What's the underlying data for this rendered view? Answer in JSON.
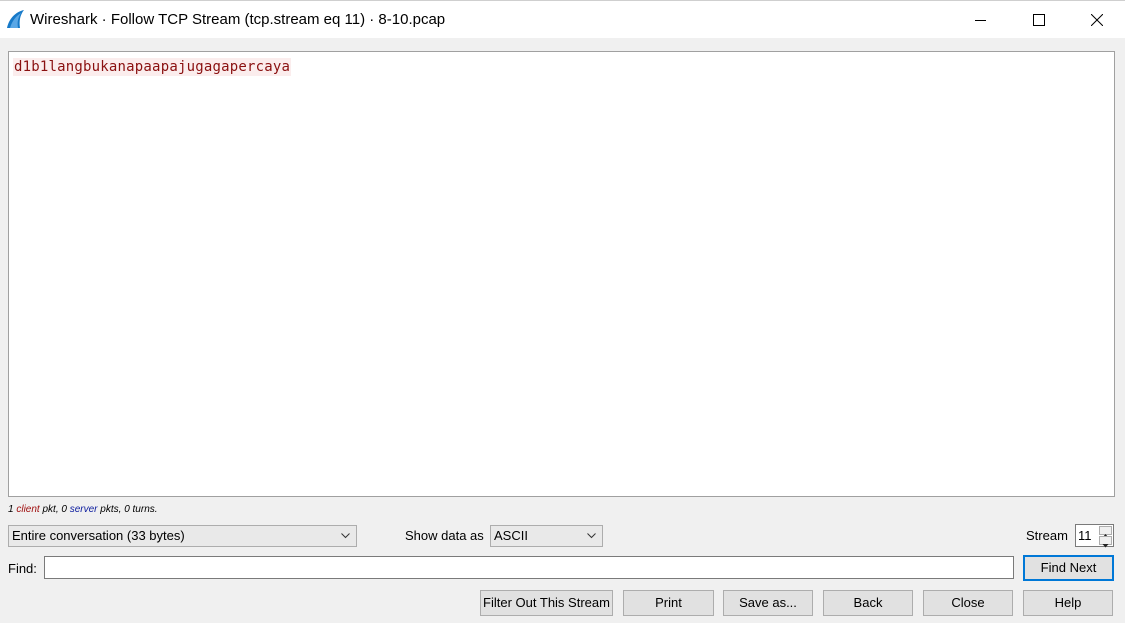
{
  "window": {
    "title": "Wireshark · Follow TCP Stream (tcp.stream eq 11) · 8-10.pcap",
    "controls": [
      "minimize-icon",
      "maximize-icon",
      "close-icon"
    ]
  },
  "stream": {
    "content": "d1b1langbukanapaapajugagapercaya",
    "client_color": "#8a1010",
    "client_bg": "#fbeded"
  },
  "stats": {
    "client_count": "1",
    "client_word": "client",
    "mid": " pkt, 0 ",
    "server_word": "server",
    "tail": " pkts, 0 turns."
  },
  "controls": {
    "conversation_select": "Entire conversation (33 bytes)",
    "show_data_label": "Show data as",
    "show_data_select": "ASCII",
    "stream_label": "Stream",
    "stream_value": "11",
    "find_label": "Find:",
    "find_value": "",
    "find_next": "Find Next"
  },
  "buttons": {
    "filter_out": "Filter Out This Stream",
    "print": "Print",
    "save_as": "Save as...",
    "back": "Back",
    "close": "Close",
    "help": "Help"
  }
}
